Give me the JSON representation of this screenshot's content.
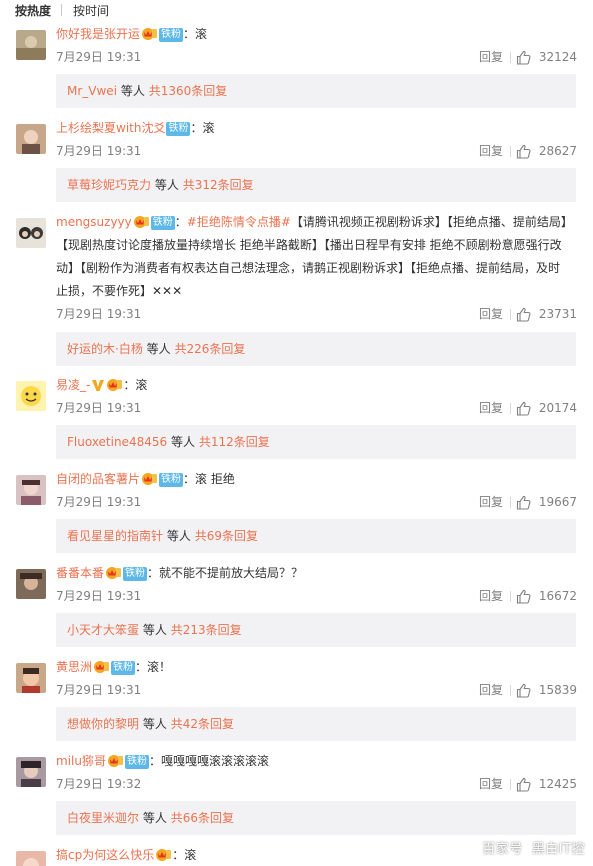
{
  "sort_tabs": {
    "hot": "按热度",
    "time": "按时间"
  },
  "common": {
    "reply": "回复",
    "fan_badge": "铁粉",
    "others": "等人",
    "colon": "："
  },
  "comments": [
    {
      "user": "你好我是张开运",
      "text": "滚",
      "time": "7月29日 19:31",
      "likes": "32124",
      "sub_user": "Mr_Vwei",
      "sub_count": "共1360条回复"
    },
    {
      "user": "上杉绘梨夏with沈爻",
      "text": "滚",
      "time": "7月29日 19:31",
      "likes": "28627",
      "sub_user": "草莓珍妮巧克力",
      "sub_count": "共312条回复"
    },
    {
      "user": "mengsuzyyy",
      "hashtag": "#拒绝陈情令点播#",
      "text1": "【请腾讯视频正视剧粉诉求】【拒绝点播、提前结局】",
      "text2": "【现剧热度讨论度播放量持续增长 拒绝半路截断】【播出日程早有安排 拒绝不顾剧粉意愿强行改",
      "text3": "动】【剧粉作为消费者有权表达自己想法理念，请鹅正视剧粉诉求】【拒绝点播、提前结局，及时",
      "text4": "止损，不要作死】✕✕✕",
      "time": "7月29日 19:31",
      "likes": "23731",
      "sub_user": "好运的木·白杨",
      "sub_count": "共226条回复"
    },
    {
      "user": "易凌_-",
      "text": "滚",
      "time": "7月29日 19:31",
      "likes": "20174",
      "sub_user": "Fluoxetine48456",
      "sub_count": "共112条回复"
    },
    {
      "user": "自闭的品客薯片",
      "text": "滚 拒绝",
      "time": "7月29日 19:31",
      "likes": "19667",
      "sub_user": "看见星星的指南针",
      "sub_count": "共69条回复"
    },
    {
      "user": "番番本番",
      "text": "就不能不提前放大结局？？",
      "time": "7月29日 19:31",
      "likes": "16672",
      "sub_user": "小天才大笨蛋",
      "sub_count": "共213条回复"
    },
    {
      "user": "黄思洲",
      "text": "滚！",
      "time": "7月29日 19:31",
      "likes": "15839",
      "sub_user": "想做你的黎明",
      "sub_count": "共42条回复"
    },
    {
      "user": "milu猕哥",
      "text": "嘎嘎嘎嘎滚滚滚滚滚",
      "time": "7月29日 19:32",
      "likes": "12425",
      "sub_user": "白夜里米迦尔",
      "sub_count": "共66条回复"
    },
    {
      "user": "搞cp为何这么快乐",
      "text": "滚"
    }
  ],
  "watermark": {
    "left": "百家号",
    "right": "黑白IT控"
  },
  "colors": {
    "accent": "#eb7350",
    "fan_badge": "#5db8e8",
    "sub_bg": "#f2f2f5",
    "meta": "#808080"
  }
}
